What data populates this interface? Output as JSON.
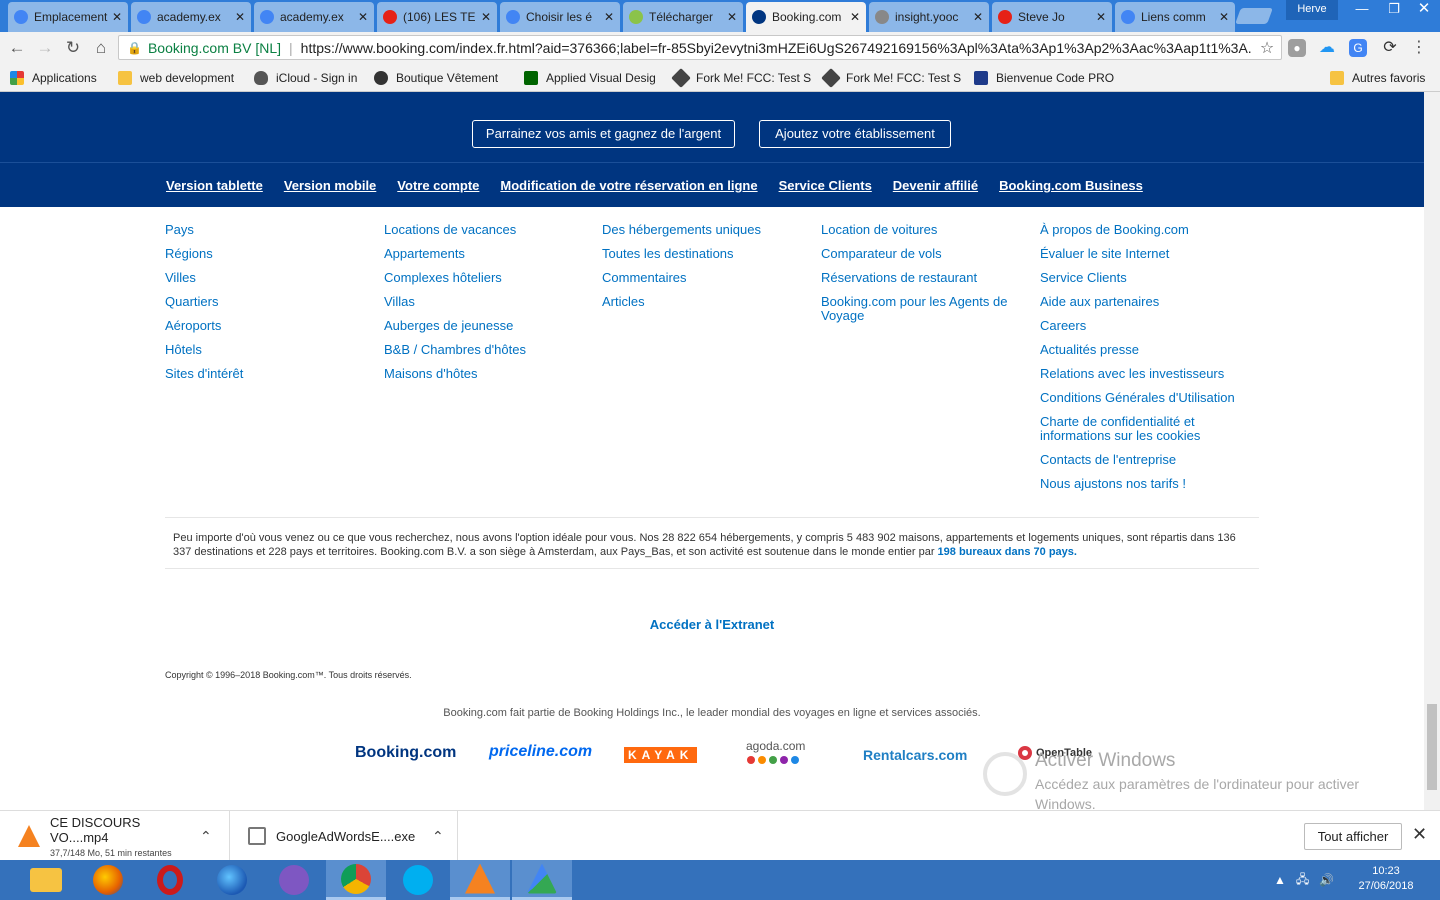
{
  "browser": {
    "tabs": [
      {
        "title": "Emplacement",
        "icon": "google-icon",
        "color": "#4285f4"
      },
      {
        "title": "academy.ex",
        "icon": "google-icon",
        "color": "#4285f4"
      },
      {
        "title": "academy.ex",
        "icon": "google-icon",
        "color": "#4285f4"
      },
      {
        "title": "(106) LES TE",
        "icon": "youtube-icon",
        "color": "#e62117"
      },
      {
        "title": "Choisir les é",
        "icon": "google-icon",
        "color": "#4285f4"
      },
      {
        "title": "Télécharger",
        "icon": "download-icon",
        "color": "#8bc34a"
      },
      {
        "title": "Booking.com",
        "icon": "booking-icon",
        "color": "#003580"
      },
      {
        "title": "insight.yooc",
        "icon": "gear-icon",
        "color": "#888888"
      },
      {
        "title": "Steve Jo",
        "icon": "youtube-icon",
        "color": "#e62117"
      },
      {
        "title": "Liens comm",
        "icon": "google-icon",
        "color": "#4285f4"
      }
    ],
    "profile": "Herve",
    "address": {
      "site": "Booking.com BV [NL]",
      "url": "https://www.booking.com/index.fr.html?aid=376366;label=fr-85Sbyi2evytni3mHZEi6UgS267492169156%3Apl%3Ata%3Ap1%3Ap2%3Aac%3Aap1t1%3A..."
    },
    "bookmarks": [
      "Applications",
      "web development",
      "iCloud - Sign in",
      "Boutique Vêtement",
      "Applied Visual Desig",
      "Fork Me! FCC: Test S",
      "Fork Me! FCC: Test S",
      "Bienvenue Code PRO"
    ],
    "other_bookmarks": "Autres favoris"
  },
  "page": {
    "top_buttons": [
      "Parrainez vos amis et gagnez de l'argent",
      "Ajoutez votre établissement"
    ],
    "sub_links": [
      "Version tablette",
      "Version mobile",
      "Votre compte",
      "Modification de votre réservation en ligne",
      "Service Clients",
      "Devenir affilié",
      "Booking.com Business"
    ],
    "columns": [
      [
        "Pays",
        "Régions",
        "Villes",
        "Quartiers",
        "Aéroports",
        "Hôtels",
        "Sites d'intérêt"
      ],
      [
        "Locations de vacances",
        "Appartements",
        "Complexes hôteliers",
        "Villas",
        "Auberges de jeunesse",
        "B&B / Chambres d'hôtes",
        "Maisons d'hôtes"
      ],
      [
        "Des hébergements uniques",
        "Toutes les destinations",
        "Commentaires",
        "Articles"
      ],
      [
        "Location de voitures",
        "Comparateur de vols",
        "Réservations de restaurant",
        "Booking.com pour les Agents de Voyage"
      ],
      [
        "À propos de Booking.com",
        "Évaluer le site Internet",
        "Service Clients",
        "Aide aux partenaires",
        "Careers",
        "Actualités presse",
        "Relations avec les investisseurs",
        "Conditions Générales d'Utilisation",
        "Charte de confidentialité et informations sur les cookies",
        "Contacts de l'entreprise",
        "Nous ajustons nos tarifs !"
      ]
    ],
    "notice_text": "Peu importe d'où vous venez ou ce que vous recherchez, nous avons l'option idéale pour vous. Nos 28 822 654 hébergements, y compris 5 483 902 maisons, appartements et logements uniques, sont répartis dans 136 337 destinations et 228 pays et territoires. Booking.com B.V. a son siège à Amsterdam, aux Pays_Bas, et son activité est soutenue dans le monde entier par ",
    "notice_link": "198 bureaux dans 70 pays.",
    "extranet": "Accéder à l'Extranet",
    "copyright": "Copyright © 1996–2018 Booking.com™. Tous droits réservés.",
    "holdings": "Booking.com fait partie de Booking Holdings Inc., le leader mondial des voyages en ligne et services associés.",
    "brands": [
      "Booking.com",
      "priceline.com",
      "KAYAK",
      "agoda.com",
      "Rentalcars.com",
      "OpenTable"
    ],
    "activate_title": "Activer Windows",
    "activate_text": "Accédez aux paramètres de l'ordinateur pour activer Windows."
  },
  "downloads": {
    "items": [
      {
        "name": "CE DISCOURS VO....mp4",
        "status": "37,7/148 Mo, 51 min restantes"
      },
      {
        "name": "GoogleAdWordsE....exe",
        "status": ""
      }
    ],
    "show_all": "Tout afficher"
  },
  "taskbar": {
    "apps": [
      "file-explorer-icon",
      "firefox-icon",
      "opera-icon",
      "firefox-dev-icon",
      "github-desktop-icon",
      "chrome-icon",
      "skype-icon",
      "vlc-icon",
      "adwords-icon"
    ],
    "time": "10:23",
    "date": "27/06/2018"
  },
  "colors": {
    "booking_blue": "#003580",
    "link_blue": "#0071c2",
    "taskbar": "#3471bb",
    "tab_strip": "#2f7cd8"
  }
}
